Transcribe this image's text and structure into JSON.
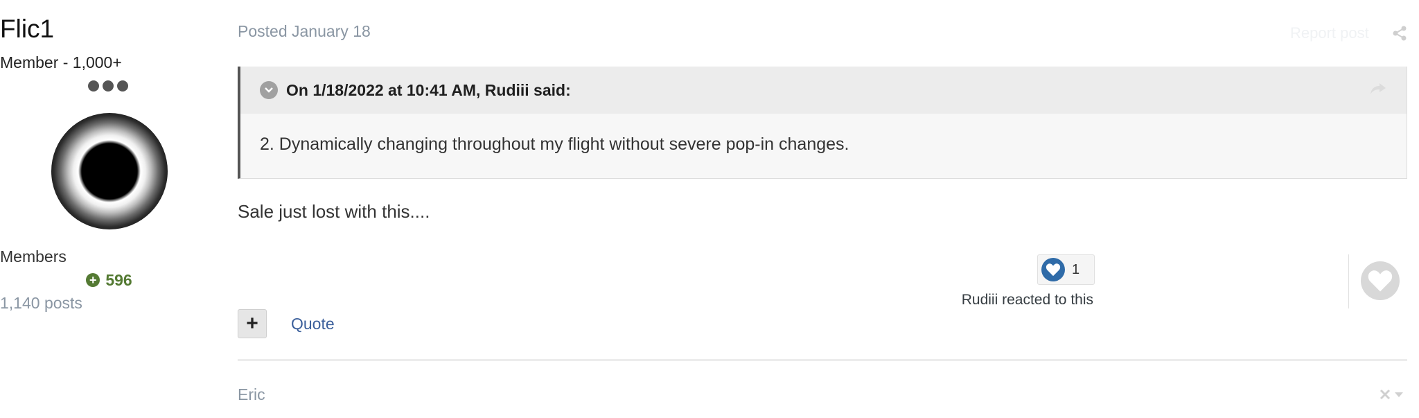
{
  "author": {
    "name": "Flic1",
    "title": "Member - 1,000+",
    "group": "Members",
    "reputation": "596",
    "posts": "1,140 posts"
  },
  "post": {
    "date": "Posted January 18",
    "report_label": "Report post",
    "quote": {
      "citation": "On 1/18/2022 at 10:41 AM, Rudiii said:",
      "body": "2. Dynamically changing throughout my flight without severe pop-in changes."
    },
    "content": "Sale just lost with this....",
    "reactions": {
      "count": "1",
      "text": "Rudiii reacted to this"
    },
    "actions": {
      "multiquote_label": "+",
      "quote_label": "Quote"
    }
  },
  "next_post": {
    "author": "Eric"
  },
  "colors": {
    "reputation_green": "#547a33",
    "link_blue": "#3b5f9b",
    "reaction_blue": "#2f6ba8",
    "muted": "#8a96a3"
  }
}
